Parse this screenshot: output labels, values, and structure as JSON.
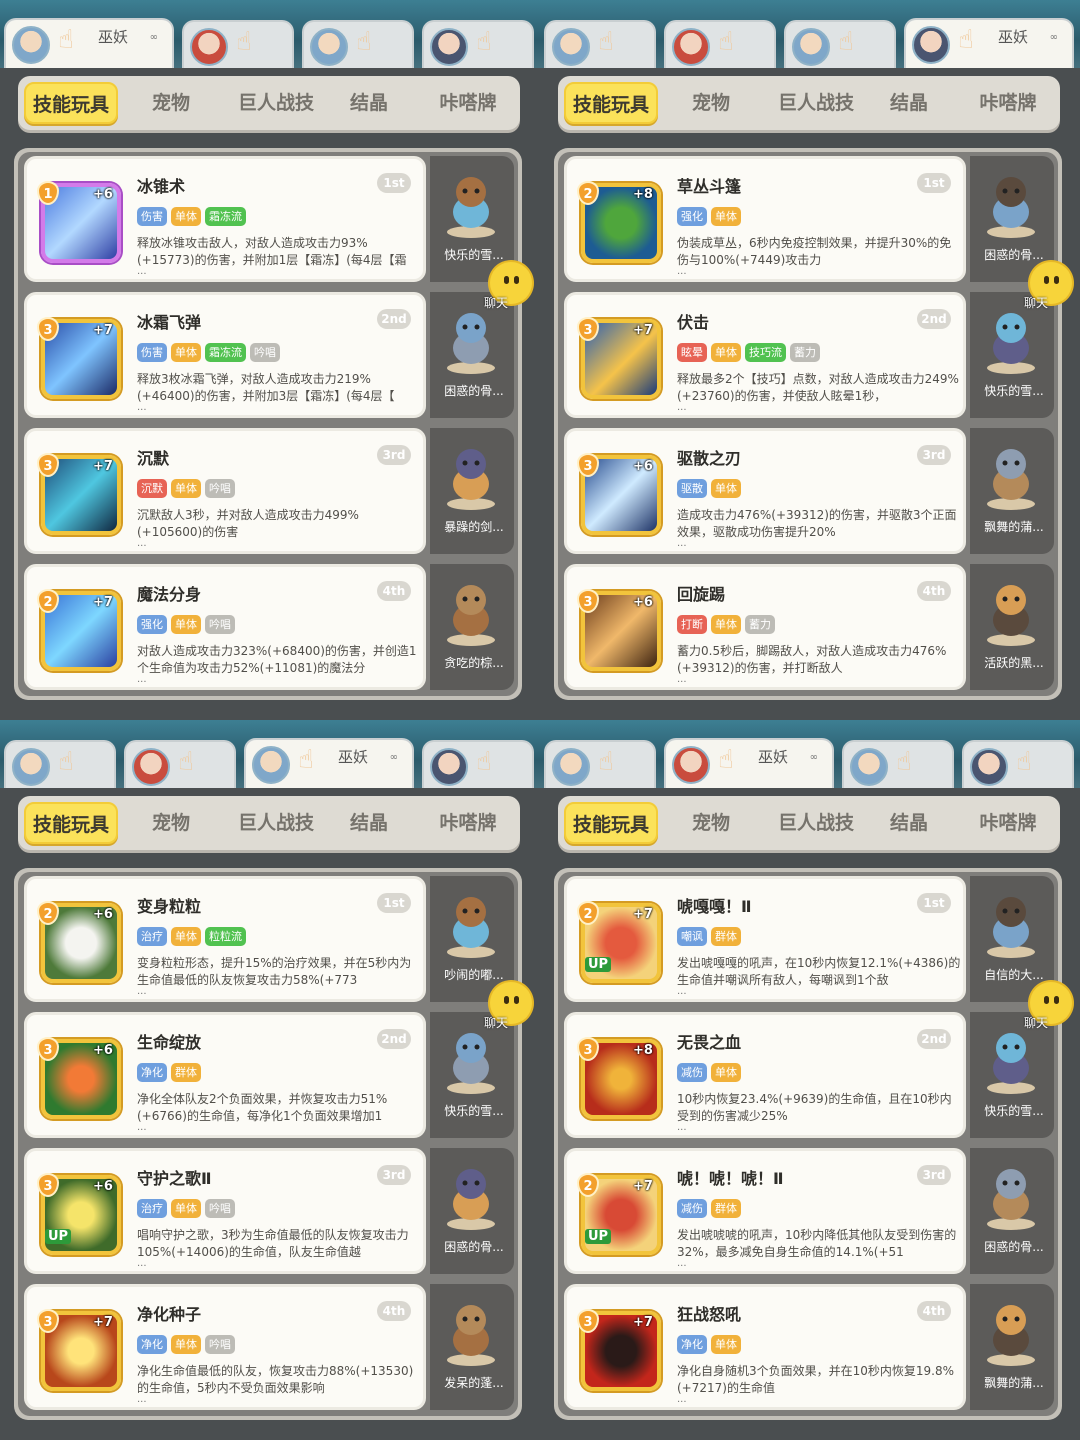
{
  "colors": {
    "active_tab_bg": "#fbe25a",
    "tag_blue": "#6f9fde",
    "tag_orange": "#f1b13a",
    "tag_green": "#51c250",
    "tag_gray": "#bdbcb6",
    "tag_red": "#e76355",
    "number_green": "#4aa93c"
  },
  "panels": [
    {
      "char_tab_name": "巫妖",
      "char_tab_dots": "∞",
      "tabs": [
        "技能玩具",
        "宠物",
        "巨人战技",
        "结晶",
        "咔嗒牌"
      ],
      "chat_label": "聊天",
      "cards": [
        {
          "title": "冰锥术",
          "rank": "1st",
          "level": "1",
          "plus": "+6",
          "icon": "ice-shard-icon",
          "tags": [
            "伤害",
            "单体",
            "霜冻流"
          ],
          "desc": "释放冰锥攻击敌人，对敌人造成攻击力93%(+15773)的伤害，并附加1层【霜冻】(每4层【霜",
          "pet": "快乐的雪..."
        },
        {
          "title": "冰霜飞弹",
          "rank": "2nd",
          "level": "3",
          "plus": "+7",
          "icon": "frost-missile-icon",
          "tags": [
            "伤害",
            "单体",
            "霜冻流",
            "吟唱"
          ],
          "desc": "释放3枚冰霜飞弹，对敌人造成攻击力219%(+46400)的伤害，并附加3层【霜冻】(每4层【",
          "pet": "困惑的骨..."
        },
        {
          "title": "沉默",
          "rank": "3rd",
          "level": "3",
          "plus": "+7",
          "icon": "silence-icon",
          "tags": [
            "沉默",
            "单体",
            "吟唱"
          ],
          "desc": "沉默敌人3秒，并对敌人造成攻击力499%(+105600)的伤害",
          "pet": "暴躁的剑..."
        },
        {
          "title": "魔法分身",
          "rank": "4th",
          "level": "2",
          "plus": "+7",
          "icon": "magic-clone-icon",
          "tags": [
            "强化",
            "单体",
            "吟唱"
          ],
          "desc": "对敌人造成攻击力323%(+68400)的伤害，并创造1个生命值为攻击力52%(+11081)的魔法分",
          "pet": "贪吃的棕..."
        }
      ]
    },
    {
      "char_tab_name": "巫妖",
      "char_tab_dots": "∞",
      "tabs": [
        "技能玩具",
        "宠物",
        "巨人战技",
        "结晶",
        "咔嗒牌"
      ],
      "chat_label": "聊天",
      "cards": [
        {
          "title": "草丛斗篷",
          "rank": "1st",
          "level": "2",
          "plus": "+8",
          "icon": "bush-cloak-icon",
          "tags": [
            "强化",
            "单体"
          ],
          "desc": "伪装成草丛，6秒内免疫控制效果，并提升30%的免伤与100%(+7449)攻击力",
          "pet": "困惑的骨..."
        },
        {
          "title": "伏击",
          "rank": "2nd",
          "level": "3",
          "plus": "+7",
          "icon": "ambush-icon",
          "tags": [
            "眩晕",
            "单体",
            "技巧流",
            "蓄力"
          ],
          "desc": "释放最多2个【技巧】点数，对敌人造成攻击力249%(+23760)的伤害，并使敌人眩晕1秒，",
          "pet": "快乐的雪..."
        },
        {
          "title": "驱散之刃",
          "rank": "3rd",
          "level": "3",
          "plus": "+6",
          "icon": "dispel-blade-icon",
          "tags": [
            "驱散",
            "单体"
          ],
          "desc": "造成攻击力476%(+39312)的伤害，并驱散3个正面效果，驱散成功伤害提升20%",
          "pet": "飘舞的蒲..."
        },
        {
          "title": "回旋踢",
          "rank": "4th",
          "level": "3",
          "plus": "+6",
          "icon": "spin-kick-icon",
          "tags": [
            "打断",
            "单体",
            "蓄力"
          ],
          "desc": "蓄力0.5秒后，脚踢敌人，对敌人造成攻击力476%(+39312)的伤害，并打断敌人",
          "pet": "活跃的黑..."
        }
      ]
    },
    {
      "char_tab_name": "巫妖",
      "char_tab_dots": "∞",
      "tabs": [
        "技能玩具",
        "宠物",
        "巨人战技",
        "结晶",
        "咔嗒牌"
      ],
      "chat_label": "聊天",
      "cards": [
        {
          "title": "变身粒粒",
          "rank": "1st",
          "level": "2",
          "plus": "+6",
          "icon": "owl-transform-icon",
          "tags": [
            "治疗",
            "单体",
            "粒粒流"
          ],
          "desc": "变身粒粒形态，提升15%的治疗效果，并在5秒内为生命值最低的队友恢复攻击力58%(+773",
          "pet": "吵闹的嘟..."
        },
        {
          "title": "生命绽放",
          "rank": "2nd",
          "level": "3",
          "plus": "+6",
          "icon": "life-bloom-icon",
          "tags": [
            "净化",
            "群体"
          ],
          "desc": "净化全体队友2个负面效果，并恢复攻击力51%(+6766)的生命值，每净化1个负面效果增加1",
          "pet": "快乐的雪..."
        },
        {
          "title": "守护之歌Ⅱ",
          "rank": "3rd",
          "level": "3",
          "plus": "+6",
          "icon": "guardian-song-icon",
          "up": "UP",
          "tags": [
            "治疗",
            "单体",
            "吟唱"
          ],
          "desc": "唱响守护之歌，3秒为生命值最低的队友恢复攻击力105%(+14006)的生命值，队友生命值越",
          "pet": "困惑的骨..."
        },
        {
          "title": "净化种子",
          "rank": "4th",
          "level": "3",
          "plus": "+7",
          "icon": "purify-seed-icon",
          "tags": [
            "净化",
            "单体",
            "吟唱"
          ],
          "desc": "净化生命值最低的队友，恢复攻击力88%(+13530)的生命值，5秒内不受负面效果影响",
          "pet": "发呆的蓬..."
        }
      ]
    },
    {
      "char_tab_name": "巫妖",
      "char_tab_dots": "∞",
      "tabs": [
        "技能玩具",
        "宠物",
        "巨人战技",
        "结晶",
        "咔嗒牌"
      ],
      "chat_label": "聊天",
      "cards": [
        {
          "title": "唬嘎嘎！Ⅱ",
          "rank": "1st",
          "level": "2",
          "plus": "+7",
          "icon": "roar-icon",
          "up": "UP",
          "tags": [
            "嘲讽",
            "群体"
          ],
          "desc": "发出唬嘎嘎的吼声，在10秒内恢复12.1%(+4386)的生命值并嘲讽所有敌人，每嘲讽到1个敌",
          "pet": "自信的大..."
        },
        {
          "title": "无畏之血",
          "rank": "2nd",
          "level": "3",
          "plus": "+8",
          "icon": "fearless-blood-icon",
          "tags": [
            "减伤",
            "单体"
          ],
          "desc": "10秒内恢复23.4%(+9639)的生命值，且在10秒内受到的伤害减少25%",
          "pet": "快乐的雪..."
        },
        {
          "title": "唬！唬！唬！Ⅱ",
          "rank": "3rd",
          "level": "2",
          "plus": "+7",
          "icon": "shout-icon",
          "up": "UP",
          "tags": [
            "减伤",
            "群体"
          ],
          "desc": "发出唬唬唬的吼声，10秒内降低其他队友受到伤害的32%，最多减免自身生命值的14.1%(+51",
          "pet": "困惑的骨..."
        },
        {
          "title": "狂战怒吼",
          "rank": "4th",
          "level": "3",
          "plus": "+7",
          "icon": "berserk-roar-icon",
          "tags": [
            "净化",
            "单体"
          ],
          "desc": "净化自身随机3个负面效果，并在10秒内恢复19.8%(+7217)的生命值",
          "pet": "飘舞的蒲..."
        }
      ]
    }
  ]
}
